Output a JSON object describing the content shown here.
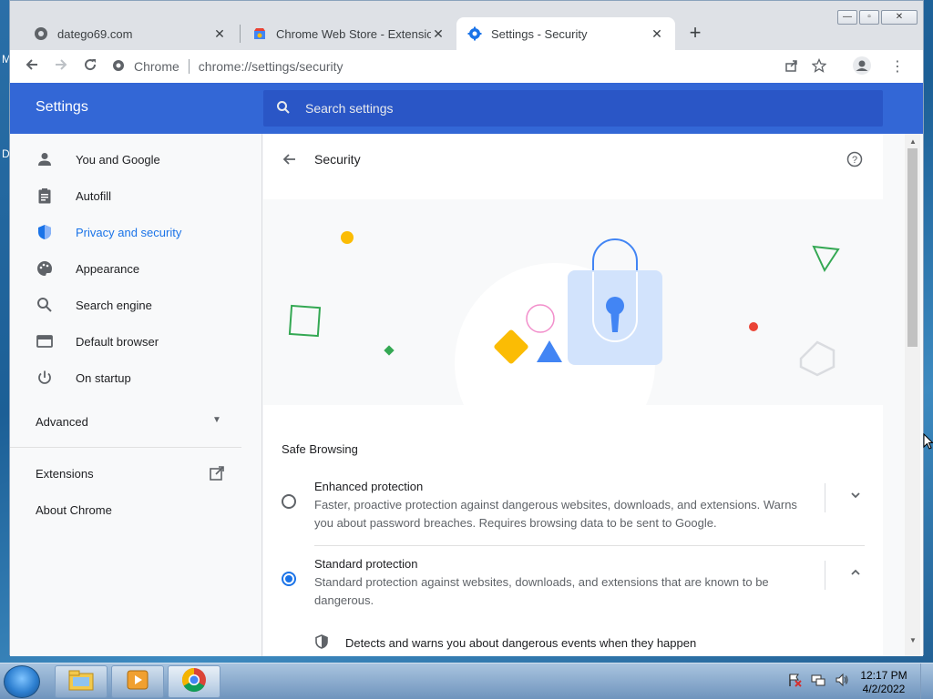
{
  "browser": {
    "tabs": [
      {
        "title": "datego69.com",
        "favicon": "globe-icon",
        "active": false
      },
      {
        "title": "Chrome Web Store - Extensions",
        "favicon": "chrome-web-store-icon",
        "active": false
      },
      {
        "title": "Settings - Security",
        "favicon": "gear-icon",
        "active": true
      }
    ],
    "omnibox": {
      "site_label": "Chrome",
      "url": "chrome://settings/security"
    }
  },
  "settings": {
    "header_title": "Settings",
    "search_placeholder": "Search settings",
    "sidebar": {
      "items": [
        {
          "label": "You and Google",
          "icon": "person-icon"
        },
        {
          "label": "Autofill",
          "icon": "clipboard-icon"
        },
        {
          "label": "Privacy and security",
          "icon": "shield-icon",
          "active": true
        },
        {
          "label": "Appearance",
          "icon": "palette-icon"
        },
        {
          "label": "Search engine",
          "icon": "search-icon"
        },
        {
          "label": "Default browser",
          "icon": "browser-window-icon"
        },
        {
          "label": "On startup",
          "icon": "power-icon"
        }
      ],
      "advanced": "Advanced",
      "extensions": "Extensions",
      "about": "About Chrome"
    },
    "section": {
      "title": "Security",
      "safe_browsing_label": "Safe Browsing",
      "options": [
        {
          "title": "Enhanced protection",
          "description": "Faster, proactive protection against dangerous websites, downloads, and extensions. Warns you about password breaches. Requires browsing data to be sent to Google.",
          "selected": false,
          "expanded": false
        },
        {
          "title": "Standard protection",
          "description": "Standard protection against websites, downloads, and extensions that are known to be dangerous.",
          "selected": true,
          "expanded": true
        }
      ],
      "detail_text": "Detects and warns you about dangerous events when they happen"
    }
  },
  "taskbar": {
    "time": "12:17 PM",
    "date": "4/2/2022"
  },
  "colors": {
    "accent": "#1a73e8",
    "header": "#3367d6",
    "lock": "#d2e3fc"
  }
}
